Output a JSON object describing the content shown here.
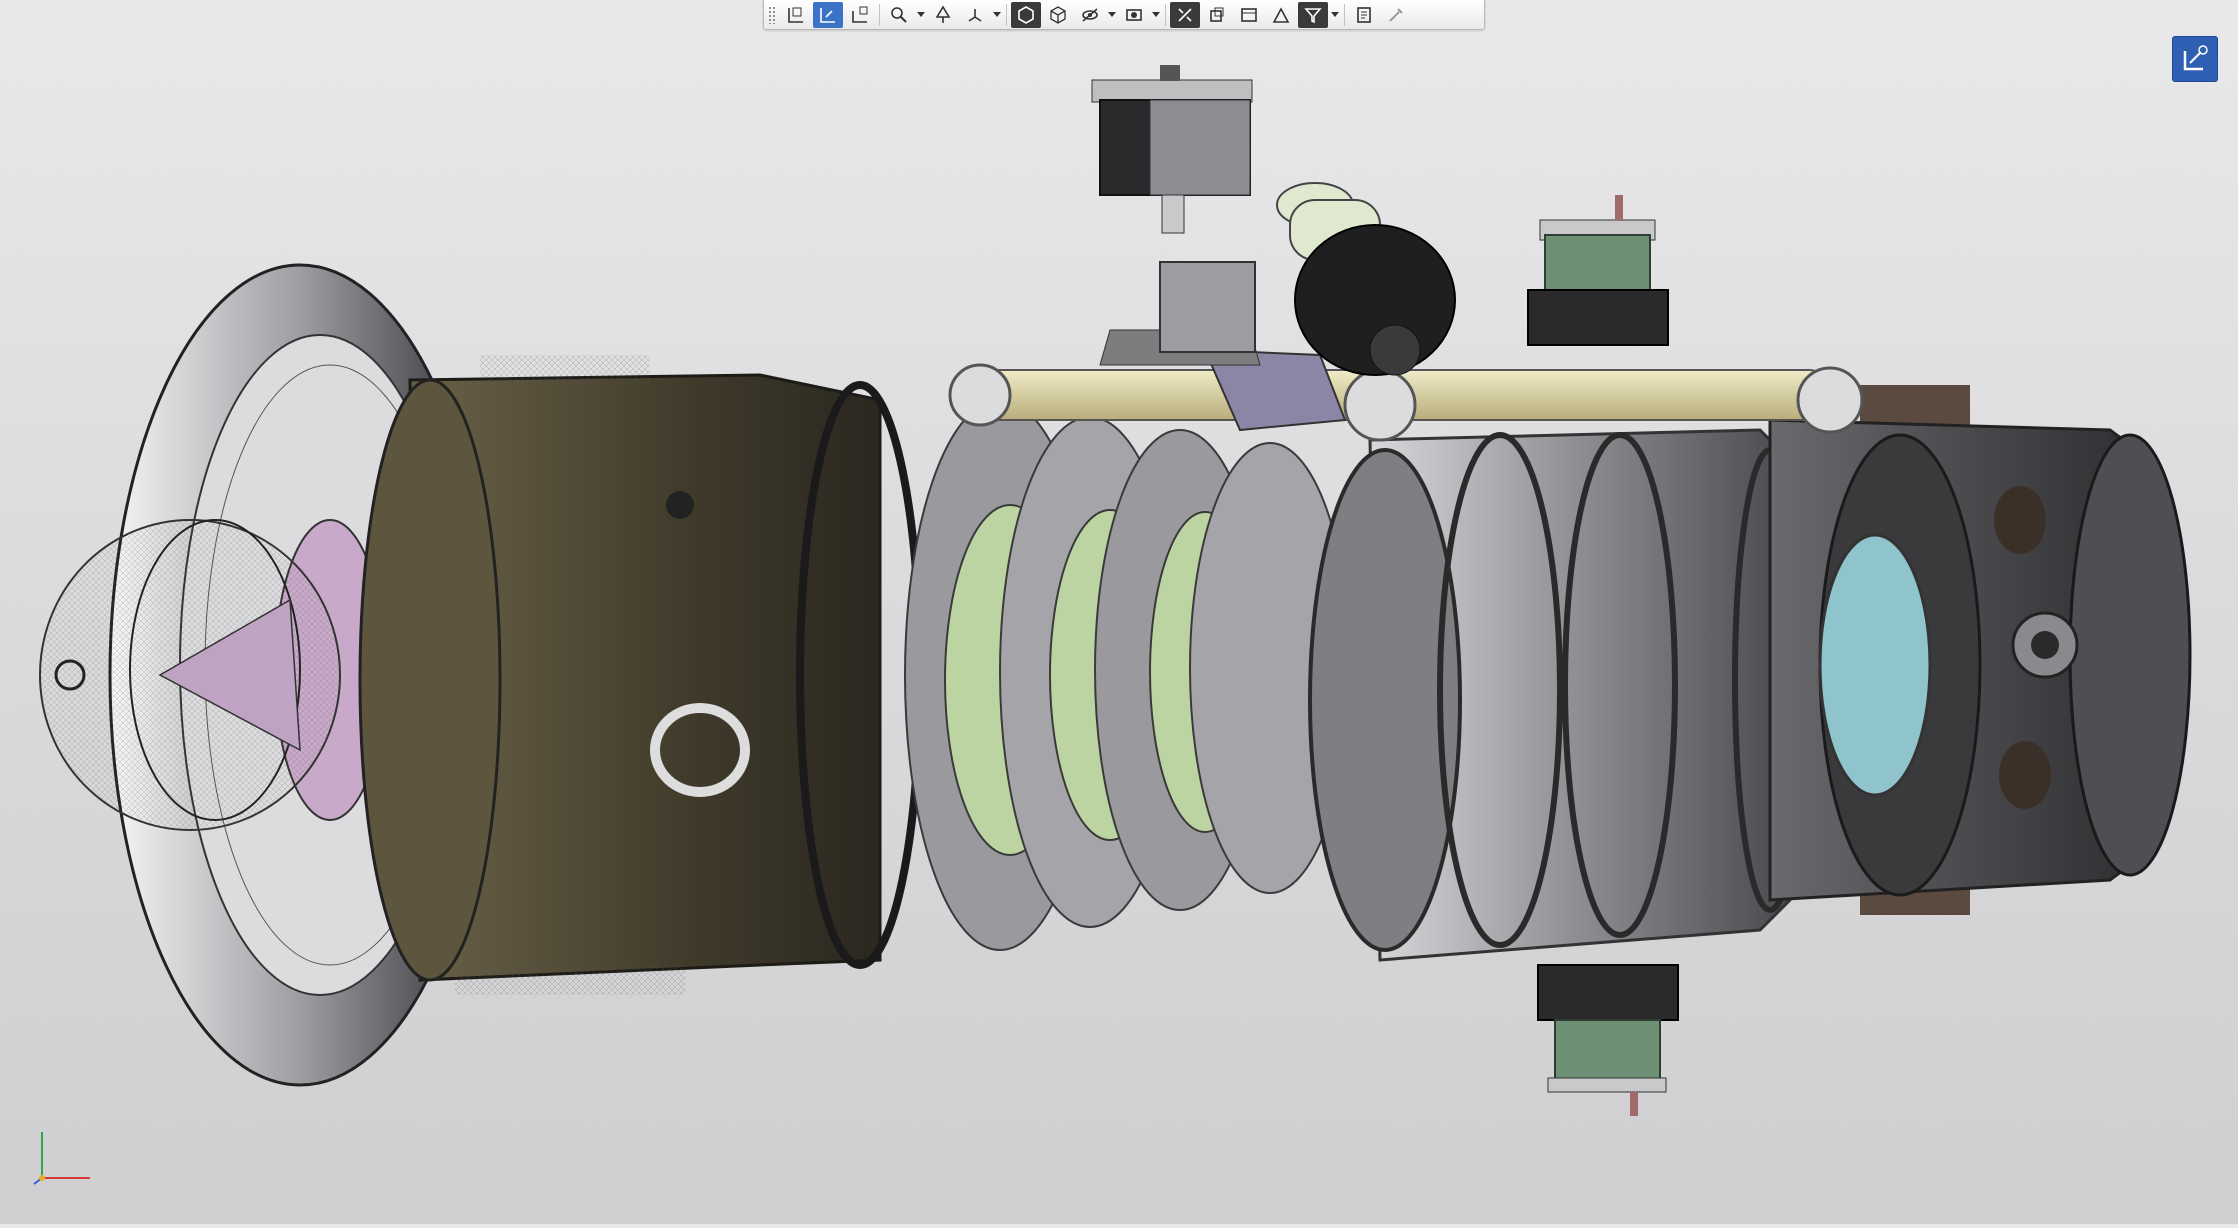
{
  "viewport": {
    "model": "gas-turbine-engine-exploded-view"
  },
  "toolbar": {
    "buttons": [
      {
        "name": "zoom-to-fit-icon"
      },
      {
        "name": "zoom-to-area-icon"
      },
      {
        "name": "previous-view-icon"
      },
      {
        "name": "section-view-icon"
      },
      {
        "name": "dynamic-annotation-views-icon"
      },
      {
        "name": "view-orientation-icon"
      },
      {
        "name": "display-style-icon"
      },
      {
        "name": "hide-show-items-icon"
      },
      {
        "name": "edit-appearance-icon"
      },
      {
        "name": "apply-scene-icon"
      },
      {
        "name": "view-settings-icon"
      },
      {
        "name": "explode-view-icon"
      },
      {
        "name": "window-icon"
      },
      {
        "name": "filter-icon"
      },
      {
        "name": "display-pane-icon"
      },
      {
        "name": "color-picker-icon"
      }
    ]
  },
  "colors": {
    "background_top": "#e9e9eb",
    "background_bottom": "#cfcfd1",
    "active_button": "#3b73c8",
    "dark_button": "#3a3a3a",
    "casing_dark": "#4b4432",
    "blade_green": "#bcd3a2",
    "spinner_pink": "#c8a9c9",
    "shaft_gold": "#d8d2a8",
    "hub_cyan": "#8fc4cc",
    "module_green": "#6d9075",
    "metal_grey": "#8a8a8e"
  }
}
